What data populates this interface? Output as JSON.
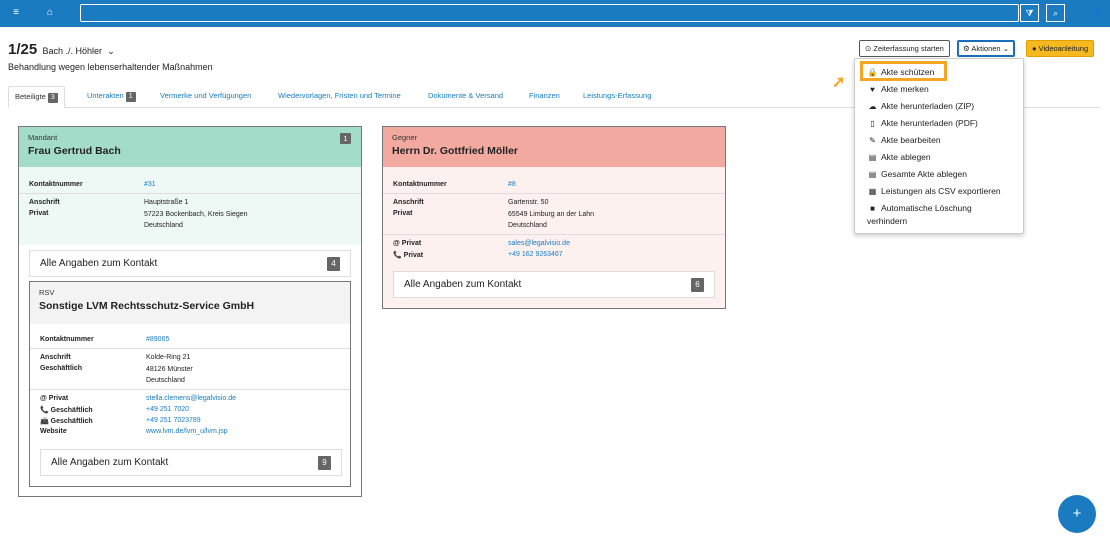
{
  "topbar": {
    "menu_icon": "≡",
    "home_icon": "⌂",
    "search_value": "",
    "filter_icon": "⧩",
    "search_icon": "⌕",
    "user_icon": "👤"
  },
  "header": {
    "index": "1/25",
    "parties": "Bach ./. Höhler",
    "parties_caret": "⌄",
    "subtitle": "Behandlung wegen lebenserhaltender Maßnahmen"
  },
  "buttons": {
    "timer": "Zeiterfassung starten",
    "timer_icon": "⊙",
    "actions": "Aktionen",
    "actions_icon": "⚙",
    "actions_caret": "⌄",
    "video": "Videoanleitung",
    "video_icon": "●"
  },
  "tabs": [
    {
      "label": "Beteiligte",
      "badge": "3"
    },
    {
      "label": "Unterakten",
      "badge": "1"
    },
    {
      "label": "Vermerke und Verfügungen"
    },
    {
      "label": "Wiedervorlagen, Fristen und Termine"
    },
    {
      "label": "Dokumente & Versand"
    },
    {
      "label": "Finanzen"
    },
    {
      "label": "Leistungs-Erfassung"
    }
  ],
  "mandant": {
    "role": "Mandant",
    "name": "Frau Gertrud Bach",
    "badge": "1",
    "kontakt_label": "Kontaktnummer",
    "kontakt": "#31",
    "anschrift_label": "Anschrift",
    "privat_label": "Privat",
    "addr1": "Hauptstraße 1",
    "addr2": "57223 Bockenbach, Kreis Siegen",
    "addr3": "Deutschland",
    "more": "Alle Angaben zum Kontakt",
    "more_badge": "4"
  },
  "rsv": {
    "role": "RSV",
    "name": "Sonstige LVM Rechtsschutz-Service GmbH",
    "kontakt_label": "Kontaktnummer",
    "kontakt": "#89065",
    "anschrift_label": "Anschrift",
    "gesch_label": "Geschäftlich",
    "addr1": "Kolde-Ring 21",
    "addr2": "48126 Münster",
    "addr3": "Deutschland",
    "email_label": "@ Privat",
    "email": "stella.clemens@legalvisio.de",
    "phone_label": "📞 Geschäftlich",
    "phone": "+49 251 7020",
    "fax_label": "📠 Geschäftlich",
    "fax": "+49 251 7023789",
    "web_label": "Website",
    "web": "www.lvm.de/lvm_u/lvm.jsp",
    "more": "Alle Angaben zum Kontakt",
    "more_badge": "9"
  },
  "gegner": {
    "role": "Gegner",
    "name": "Herrn Dr. Gottfried Möller",
    "kontakt_label": "Kontaktnummer",
    "kontakt": "#8",
    "anschrift_label": "Anschrift",
    "privat_label": "Privat",
    "addr1": "Gartenstr. 50",
    "addr2": "65549 Limburg an der Lahn",
    "addr3": "Deutschland",
    "email_label": "@ Privat",
    "email": "sales@legalvisio.de",
    "phone_label": "📞 Privat",
    "phone": "+49 162 9263467",
    "more": "Alle Angaben zum Kontakt",
    "more_badge": "6"
  },
  "menu": [
    {
      "icon": "🔒",
      "label": "Akte schützen"
    },
    {
      "icon": "♥",
      "label": "Akte merken"
    },
    {
      "icon": "☁",
      "label": "Akte herunterladen (ZIP)"
    },
    {
      "icon": "▯",
      "label": "Akte herunterladen (PDF)"
    },
    {
      "icon": "✎",
      "label": "Akte bearbeiten"
    },
    {
      "icon": "▤",
      "label": "Akte ablegen"
    },
    {
      "icon": "▤",
      "label": "Gesamte Akte ablegen"
    },
    {
      "icon": "▦",
      "label": "Leistungen als CSV exportieren"
    },
    {
      "icon": "■",
      "label": "Automatische Löschung"
    },
    {
      "icon": "",
      "label": "verhindern"
    }
  ],
  "fab_icon": "+",
  "colors": {
    "primary": "#1a7bc0",
    "mandant": "#a3dcc9",
    "gegner": "#f2aaa0",
    "highlight": "#f5a623"
  }
}
